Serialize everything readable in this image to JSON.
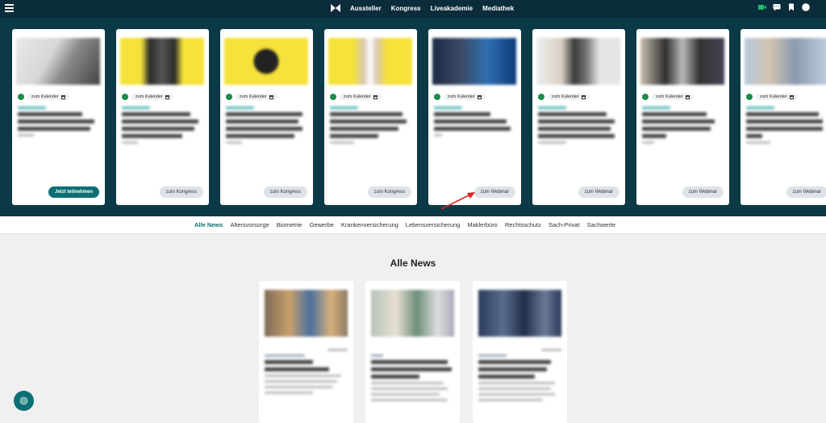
{
  "header": {
    "nav": [
      "Aussteller",
      "Kongress",
      "Liveakademie",
      "Mediathek"
    ]
  },
  "hero": {
    "cards": [
      {
        "calendar": "zum Kalender",
        "button": "Jetzt teilnehmen"
      },
      {
        "calendar": "zum Kalender",
        "button": "zum Kongress"
      },
      {
        "calendar": "zum Kalender",
        "button": "zum Kongress"
      },
      {
        "calendar": "zum Kalender",
        "button": "zum Kongress"
      },
      {
        "calendar": "zum Kalender",
        "button": "zum Webinar"
      },
      {
        "calendar": "zum Kalender",
        "button": "zum Webinar"
      },
      {
        "calendar": "zum Kalender",
        "button": "zum Webinar"
      },
      {
        "calendar": "zum Kalender",
        "button": "zum Webinar"
      }
    ]
  },
  "tabs": [
    "Alle News",
    "Altersvorsorge",
    "Biometrie",
    "Gewerbe",
    "Krankenversicherung",
    "Lebensversicherung",
    "Maklerbüro",
    "Rechtsschutz",
    "Sach-Privat",
    "Sachwerte"
  ],
  "news": {
    "title": "Alle News"
  },
  "colors": {
    "header_bg": "#0b2c3a",
    "hero_bg": "#0c3946",
    "accent": "#0c6f73",
    "calendar_dot": "#1a8d4a",
    "annotation_arrow": "#e02020"
  }
}
